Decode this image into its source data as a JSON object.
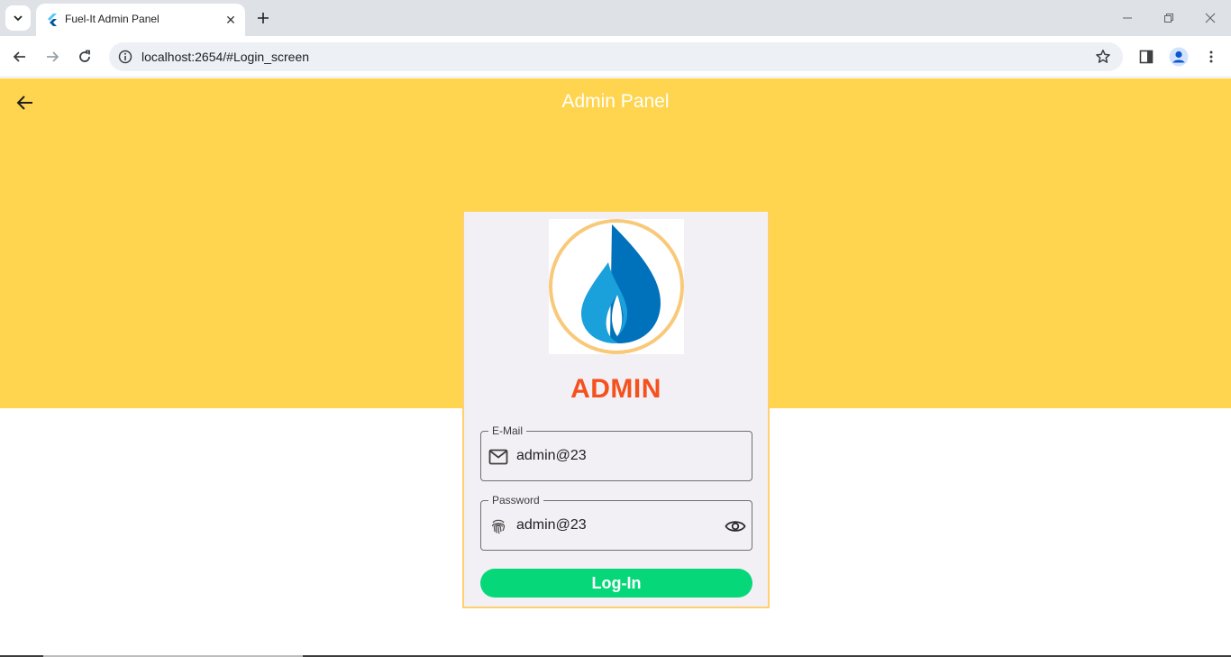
{
  "browser": {
    "tab_title": "Fuel-It Admin Panel",
    "url": "localhost:2654/#Login_screen"
  },
  "app": {
    "title": "Admin Panel",
    "admin_label": "ADMIN",
    "email": {
      "label": "E-Mail",
      "value": "admin@23"
    },
    "password": {
      "label": "Password",
      "value": "admin@23"
    },
    "login_button": "Log-In"
  },
  "colors": {
    "accent": "#ffd54f",
    "admin_label": "#f4511e",
    "login_button": "#06d87a",
    "logo_ring": "#f9c97a",
    "logo_drop": "#0072bc"
  }
}
